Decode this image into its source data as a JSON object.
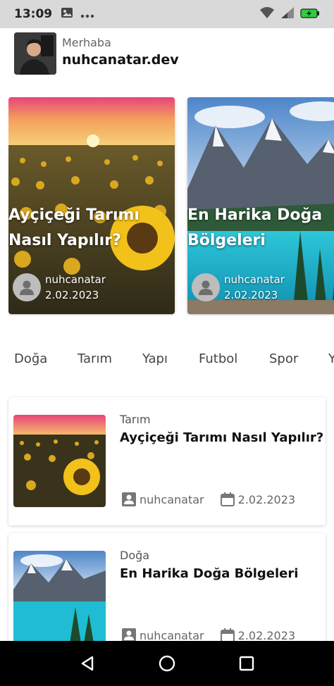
{
  "status_bar": {
    "time": "13:09",
    "icons": [
      "gallery-icon",
      "more-dots-icon",
      "wifi-icon",
      "signal-icon",
      "battery-charging-icon"
    ]
  },
  "header": {
    "greeting": "Merhaba",
    "username": "nuhcanatar.dev"
  },
  "featured": [
    {
      "title": "Ayçiçeği Tarımı Nasıl Yapılır?",
      "author": "nuhcanatar",
      "date": "2.02.2023",
      "image": "sunflower-field"
    },
    {
      "title": "En Harika Doğa Bölgeleri",
      "author": "nuhcanatar",
      "date": "2.02.2023",
      "image": "mountain-lake"
    }
  ],
  "categories": [
    "Doğa",
    "Tarım",
    "Yapı",
    "Futbol",
    "Spor",
    "Y"
  ],
  "posts": [
    {
      "category": "Tarım",
      "title": "Ayçiçeği Tarımı Nasıl Yapılır?",
      "author": "nuhcanatar",
      "date": "2.02.2023",
      "image": "sunflower-field"
    },
    {
      "category": "Doğa",
      "title": "En Harika Doğa Bölgeleri",
      "author": "nuhcanatar",
      "date": "2.02.2023",
      "image": "mountain-lake"
    }
  ],
  "nav": [
    "back-icon",
    "home-icon",
    "recents-icon"
  ],
  "colors": {
    "status_bar": "#d9d9d9",
    "battery": "#2ecc40",
    "nav_bar": "#000000"
  }
}
